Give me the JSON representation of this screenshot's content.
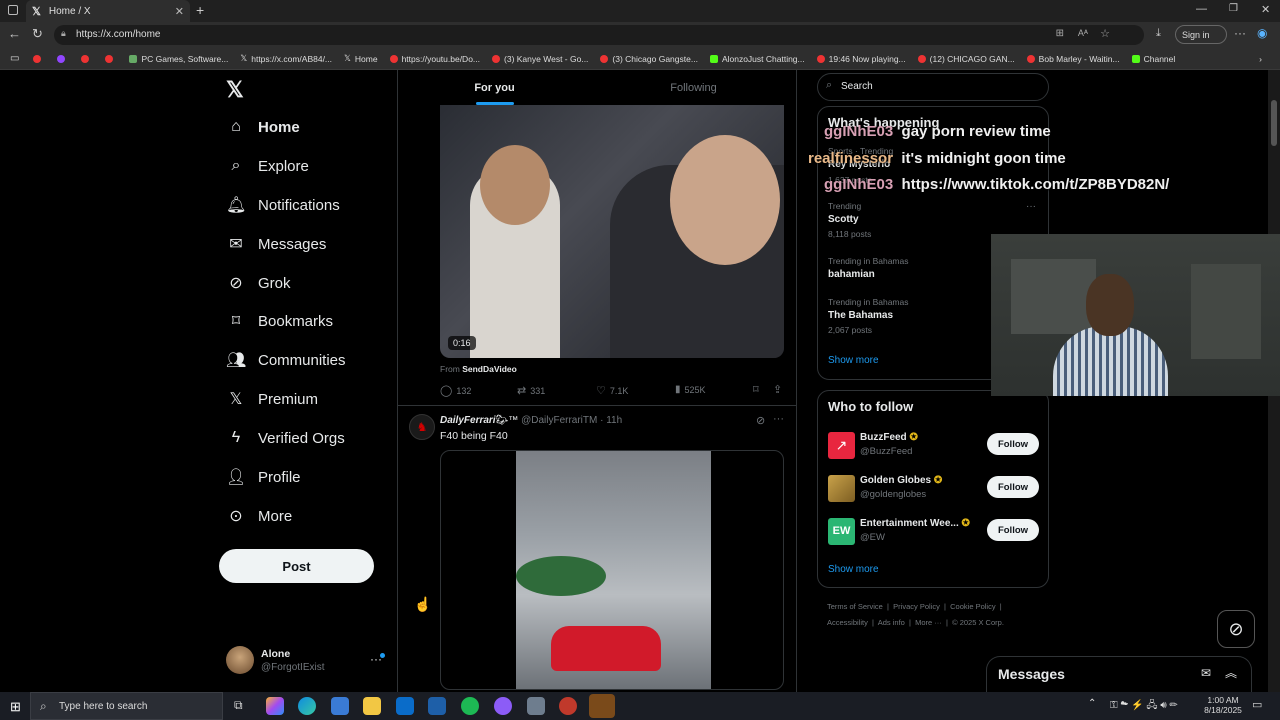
{
  "browser": {
    "tab_title": "Home / X",
    "url": "https://x.com/home",
    "sign_in": "Sign in",
    "bookmarks": [
      "PC Games, Software...",
      "https://x.com/AB84/...",
      "Home",
      "https://youtu.be/Do...",
      "(3) Kanye West - Go...",
      "(3) Chicago Gangste...",
      "AlonzoJust Chatting...",
      "19:46 Now playing...",
      "(12) CHICAGO GAN...",
      "Bob Marley - Waitin...",
      "Channel"
    ]
  },
  "nav": {
    "items": [
      "Home",
      "Explore",
      "Notifications",
      "Messages",
      "Grok",
      "Bookmarks",
      "Communities",
      "Premium",
      "Verified Orgs",
      "Profile",
      "More"
    ],
    "post_label": "Post",
    "user_name": "Alone",
    "user_handle": "@ForgotIExist"
  },
  "feed": {
    "tabs": [
      "For you",
      "Following"
    ],
    "post1": {
      "duration": "0:16",
      "from_label": "From",
      "from_name": "SendDaVideo",
      "replies": "132",
      "reposts": "331",
      "likes": "7.1K",
      "views": "525K"
    },
    "post2": {
      "name": "DailyFerrari",
      "name_suffix": "™",
      "handle": "@DailyFerrariTM",
      "time": "· 11h",
      "text": "F40 being F40"
    }
  },
  "right": {
    "search_placeholder": "Search",
    "happening_title": "What's happening",
    "trend0_context": "Sports · Trending",
    "trend0_name": "Rey Mysterio",
    "trend0_posts": "1,637 posts",
    "trends": [
      {
        "context": "Trending",
        "name": "Scotty",
        "posts": "8,118 posts"
      },
      {
        "context": "Trending in Bahamas",
        "name": "bahamian",
        "posts": ""
      },
      {
        "context": "Trending in Bahamas",
        "name": "The Bahamas",
        "posts": "2,067 posts"
      }
    ],
    "show_more": "Show more",
    "who_title": "Who to follow",
    "follow": [
      {
        "name": "BuzzFeed",
        "handle": "@BuzzFeed",
        "btn": "Follow",
        "color": "#e8263f"
      },
      {
        "name": "Golden Globes",
        "handle": "@goldenglobes",
        "btn": "Follow",
        "color": "#b08d3a"
      },
      {
        "name": "Entertainment Wee...",
        "handle": "@EW",
        "btn": "Follow",
        "color": "#2bb673"
      }
    ],
    "follow_logo_ew": "EW",
    "show_more2": "Show more",
    "footer1": [
      "Terms of Service",
      "Privacy Policy",
      "Cookie Policy"
    ],
    "footer2": [
      "Accessibility",
      "Ads info",
      "More ···",
      "© 2025 X Corp."
    ],
    "messages_title": "Messages"
  },
  "chat": [
    {
      "user": "ggINhE03",
      "msg": "gay porn review time",
      "color": "#d8a0b4"
    },
    {
      "user": "realfinessor",
      "msg": "it's midnight goon time",
      "color": "#e8b888"
    },
    {
      "user": "ggINhE03",
      "msg": "https://www.tiktok.com/t/ZP8BYD82N/",
      "color": "#d8a0b4"
    }
  ],
  "taskbar": {
    "search_placeholder": "Type here to search",
    "time": "1:00 AM",
    "date": "8/18/2025"
  }
}
